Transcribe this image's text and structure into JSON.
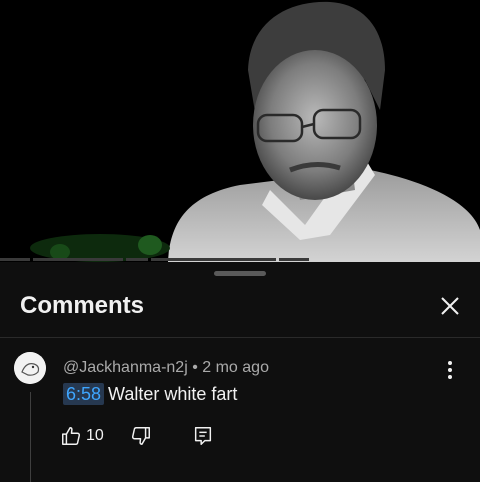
{
  "sheet": {
    "title": "Comments"
  },
  "comment": {
    "author": "@Jackhanma-n2j",
    "separator": " • ",
    "age": "2 mo ago",
    "timestamp_link": "6:58",
    "text": "Walter white fart",
    "likes": "10"
  },
  "icons": {
    "close": "close-icon",
    "more": "more-vert-icon",
    "like": "thumbs-up-icon",
    "dislike": "thumbs-down-icon",
    "reply": "reply-icon"
  },
  "colors": {
    "background": "#0f0f0f",
    "timestamp_fg": "#3ea6ff",
    "timestamp_bg": "#263850",
    "secondary_text": "#aaaaaa"
  }
}
